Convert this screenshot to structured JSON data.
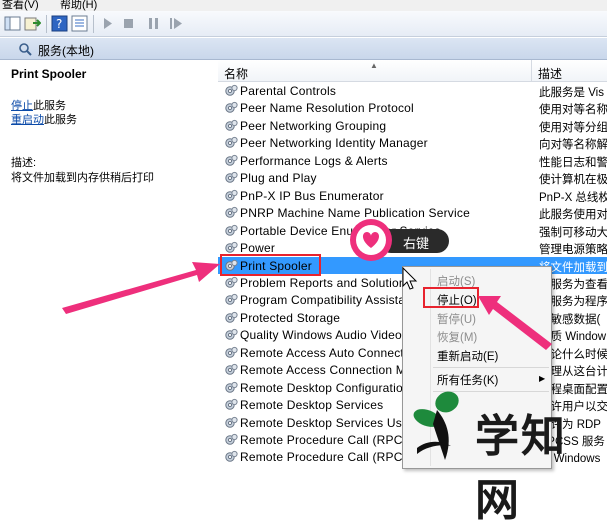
{
  "menubar": {
    "items": [
      "查看(V)",
      "帮助(H)"
    ]
  },
  "console": {
    "title": "服务(本地)"
  },
  "left_pane": {
    "service_name": "Print Spooler",
    "stop_link": "停止",
    "stop_suffix": "此服务",
    "restart_link": "重启动",
    "restart_suffix": "此服务",
    "desc_label": "描述:",
    "desc_text": "将文件加载到内存供稍后打印"
  },
  "list": {
    "col_name": "名称",
    "col_desc": "描述",
    "rows": [
      {
        "name": "Parental Controls",
        "desc": "此服务是 Vis"
      },
      {
        "name": "Peer Name Resolution Protocol",
        "desc": "使用对等名称"
      },
      {
        "name": "Peer Networking Grouping",
        "desc": "使用对等分组"
      },
      {
        "name": "Peer Networking Identity Manager",
        "desc": "向对等名称解"
      },
      {
        "name": "Performance Logs & Alerts",
        "desc": "性能日志和警"
      },
      {
        "name": "Plug and Play",
        "desc": "使计算机在极"
      },
      {
        "name": "PnP-X IP Bus Enumerator",
        "desc": "PnP-X 总线枚"
      },
      {
        "name": "PNRP Machine Name Publication Service",
        "desc": "此服务使用对"
      },
      {
        "name": "Portable Device Enumerator Service",
        "desc": "强制可移动大"
      },
      {
        "name": "Power",
        "desc": "管理电源策略"
      },
      {
        "name": "Print Spooler",
        "desc": "将文件加载到"
      },
      {
        "name": "Problem Reports and Solutions Control Panel Support",
        "desc": "此服务为查看"
      },
      {
        "name": "Program Compatibility Assistant Service",
        "desc": "此服务为程序"
      },
      {
        "name": "Protected Storage",
        "desc": "为敏感数据("
      },
      {
        "name": "Quality Windows Audio Video Experience",
        "desc": "优质 Window"
      },
      {
        "name": "Remote Access Auto Connection Manager",
        "desc": "无论什么时候"
      },
      {
        "name": "Remote Access Connection Manager",
        "desc": "管理从这台计"
      },
      {
        "name": "Remote Desktop Configuration",
        "desc": "远程桌面配置"
      },
      {
        "name": "Remote Desktop Services",
        "desc": "允许用户以交"
      },
      {
        "name": "Remote Desktop Services UserMode Port Redirector",
        "desc": "允许为 RDP"
      },
      {
        "name": "Remote Procedure Call (RPC)",
        "desc": "RPCSS 服务"
      },
      {
        "name": "Remote Procedure Call (RPC) Locator",
        "desc": "在 Windows"
      }
    ]
  },
  "context_menu": {
    "items": [
      {
        "label": "启动(S)",
        "enabled": false
      },
      {
        "label": "停止(O)",
        "enabled": true
      },
      {
        "label": "暂停(U)",
        "enabled": false
      },
      {
        "label": "恢复(M)",
        "enabled": false
      },
      {
        "label": "重新启动(E)",
        "enabled": true
      },
      {
        "label": "所有任务(K)",
        "enabled": true
      }
    ]
  },
  "callout": {
    "text": "右键"
  },
  "watermark": {
    "text": "学知网"
  },
  "colors": {
    "selection": "#3399ff",
    "highlight": "#e8232e",
    "annotation": "#ee2f7c"
  }
}
